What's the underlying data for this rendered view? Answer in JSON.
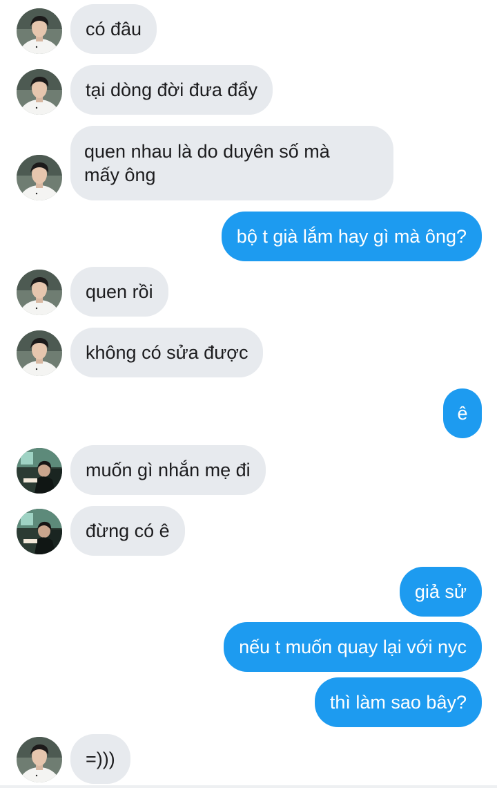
{
  "colors": {
    "incoming_bubble": "#e7eaee",
    "outgoing_bubble": "#1d9bf0",
    "outgoing_text": "#ffffff",
    "incoming_text": "#1c1c1e"
  },
  "messages": [
    {
      "direction": "incoming",
      "text": "có đâu",
      "avatar": "avatar-white-shirt"
    },
    {
      "direction": "incoming",
      "text": "tại dòng đời đưa đẩy",
      "avatar": "avatar-white-shirt"
    },
    {
      "direction": "incoming",
      "line1": "quen nhau là do duyên số mà",
      "line2": "mấy ông",
      "avatar": "avatar-white-shirt"
    },
    {
      "direction": "outgoing",
      "text": "bộ t già lắm hay gì mà ông?"
    },
    {
      "direction": "incoming",
      "text": "quen rồi",
      "avatar": "avatar-white-shirt"
    },
    {
      "direction": "incoming",
      "text": "không có sửa được",
      "avatar": "avatar-white-shirt"
    },
    {
      "direction": "outgoing",
      "text": "ê"
    },
    {
      "direction": "incoming",
      "text": "muốn gì nhắn mẹ đi",
      "avatar": "avatar-room"
    },
    {
      "direction": "incoming",
      "text": "đừng có ê",
      "avatar": "avatar-room"
    },
    {
      "direction": "outgoing",
      "text": "giả sử"
    },
    {
      "direction": "outgoing",
      "text": "nếu t muốn quay lại với nyc"
    },
    {
      "direction": "outgoing",
      "text": "thì làm sao bây?"
    },
    {
      "direction": "incoming",
      "text": "=)))",
      "avatar": "avatar-white-shirt"
    }
  ]
}
